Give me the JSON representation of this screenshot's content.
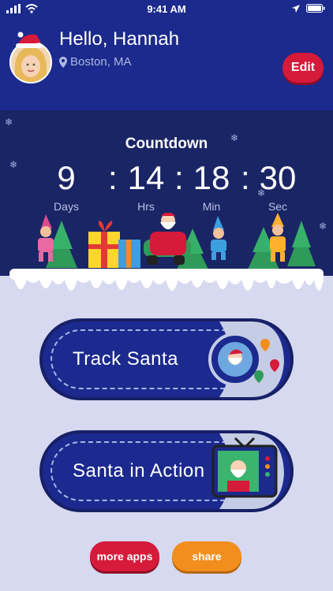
{
  "status_bar": {
    "time": "9:41 AM"
  },
  "header": {
    "greeting": "Hello, Hannah",
    "location": "Boston, MA",
    "edit_label": "Edit"
  },
  "countdown": {
    "title": "Countdown",
    "days": "9",
    "hours": "14",
    "minutes": "18",
    "seconds": "30",
    "days_label": "Days",
    "hours_label": "Hrs",
    "minutes_label": "Min",
    "seconds_label": "Sec"
  },
  "actions": {
    "track_label": "Track Santa",
    "action_label": "Santa in Action"
  },
  "footer": {
    "more_apps_label": "more apps",
    "share_label": "share"
  },
  "colors": {
    "header_bg": "#1b2a8c",
    "countdown_bg": "#1a2565",
    "page_bg": "#d6d9ef",
    "accent_red": "#d61a3a",
    "accent_orange": "#f28e1d"
  }
}
